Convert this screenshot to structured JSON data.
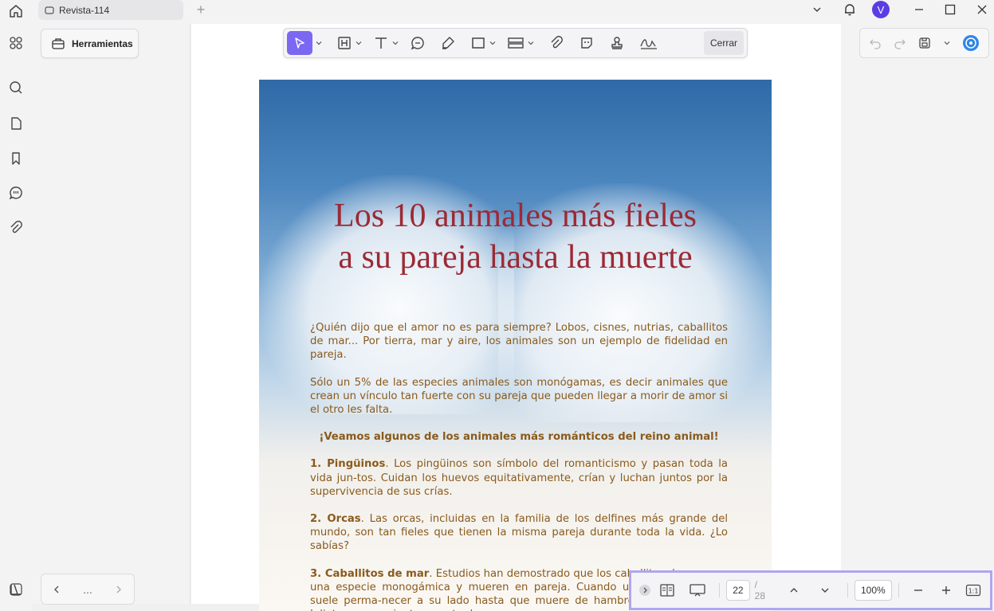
{
  "window": {
    "tab_title": "Revista-114",
    "avatar_initial": "V"
  },
  "panel": {
    "tools_label": "Herramientas",
    "pager_more": "..."
  },
  "toolbar": {
    "close_label": "Cerrar"
  },
  "page": {
    "title_line1": "Los 10 animales más fieles",
    "title_line2": "a su pareja hasta la muerte",
    "para1": "¿Quién dijo que el amor no es para siempre? Lobos, cisnes, nutrias, caballitos de mar... Por tierra, mar y aire, los animales son un ejemplo de fidelidad en pareja.",
    "para2": "Sólo un 5% de las especies animales son monógamas, es decir animales que crean un vínculo tan fuerte con su pareja que pueden llegar a morir de amor si el otro les falta.",
    "highlight": "¡Veamos algunos de los animales más románticos del reino animal!",
    "item1_title": "1. Pingüinos",
    "item1_text": ". Los pingüinos son símbolo del romanticismo y pasan toda la vida jun-tos. Cuidan los huevos equitativamente, crían y luchan juntos por la supervivencia de sus crías.",
    "item2_title": "2. Orcas",
    "item2_text": ". Las orcas, incluidas en la familia de los delfines más grande del mundo, son tan fieles que tienen la misma pareja durante toda la vida. ¿Lo sabías?",
    "item3_title": "3. Caballitos de mar",
    "item3_text": ". Estudios han demostrado que los caballitos de mar son una especie monogámica y mueren en pareja. Cuando uno muere, el otro suele perma-necer a su lado hasta que muere de hambre. Como Romeo y Julieta, mueren juntos mente de amor."
  },
  "pagebar": {
    "current_page": "22",
    "total_pages": "/ 28",
    "zoom": "100%",
    "fit_label": "1:1"
  },
  "colors": {
    "accent": "#7b68f2",
    "title_red": "#9b2a35",
    "body_brown": "#8a5a1c",
    "highlight_border": "#b0a6ef"
  },
  "icons": {
    "titlebar": [
      "home-icon",
      "document-icon",
      "add-tab-icon",
      "chevron-down-icon",
      "bell-icon",
      "minimize-icon",
      "maximize-icon",
      "close-icon"
    ],
    "rail": [
      "grid-icon",
      "search-icon",
      "pages-icon",
      "bookmark-icon",
      "comment-icon",
      "attachment-icon",
      "layers-icon"
    ],
    "toolbar": [
      "cursor-icon",
      "textbox-icon",
      "text-icon",
      "comment-icon",
      "highlighter-icon",
      "rectangle-icon",
      "stamp-icon",
      "paperclip-icon",
      "sticker-icon",
      "seal-icon",
      "signature-icon"
    ]
  }
}
